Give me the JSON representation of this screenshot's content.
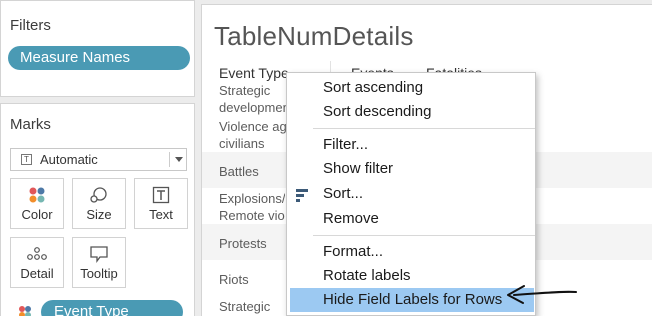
{
  "filters": {
    "title": "Filters",
    "pill": "Measure Names"
  },
  "marks": {
    "title": "Marks",
    "mark_type": "Automatic",
    "buttons": {
      "color": "Color",
      "size": "Size",
      "text": "Text",
      "detail": "Detail",
      "tooltip": "Tooltip"
    },
    "pill": "Event Type"
  },
  "sheet": {
    "title": "TableNumDetails",
    "columns": [
      "Event Type",
      "Events",
      "Fatalities"
    ],
    "rows": [
      [
        "Strategic",
        "developments"
      ],
      [
        "Violence ag",
        "civilians"
      ],
      [
        "Battles"
      ],
      [
        "Explosions/",
        "Remote vio"
      ],
      [
        "Protests"
      ],
      [
        "Riots"
      ],
      [
        "Strategic"
      ]
    ]
  },
  "context_menu": {
    "items": [
      "Sort ascending",
      "Sort descending",
      "Filter...",
      "Show filter",
      "Sort...",
      "Remove",
      "Format...",
      "Rotate labels",
      "Hide Field Labels for Rows"
    ],
    "highlighted": "Hide Field Labels for Rows"
  },
  "colors": {
    "pill": "#4a9ab4",
    "highlight": "#9cc9f2",
    "panel_bg": "#ececec"
  },
  "icons": [
    "text-mark-icon",
    "color-dots-icon",
    "size-icon",
    "text-icon",
    "detail-icon",
    "tooltip-icon",
    "sort-icon",
    "drawn-arrow-icon"
  ]
}
